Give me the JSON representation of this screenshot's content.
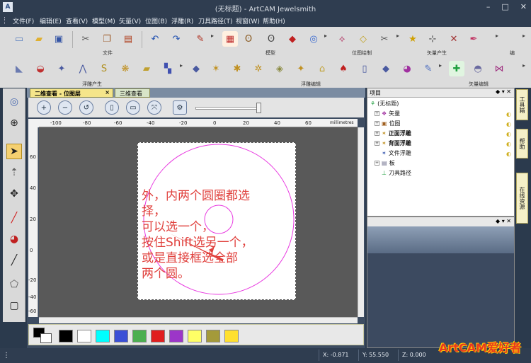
{
  "window": {
    "title": "(无标题) - ArtCAM Jewelsmith",
    "minimize": "–",
    "maximize": "□",
    "close": "✕"
  },
  "menu": {
    "items": [
      "文件(F)",
      "编辑(E)",
      "查看(V)",
      "模型(M)",
      "矢量(V)",
      "位图(B)",
      "浮雕(R)",
      "刀具路径(T)",
      "视窗(W)",
      "帮助(H)"
    ]
  },
  "toolbars": {
    "file_label": "文件",
    "model_label": "模型",
    "bitmap_label": "位图绘制",
    "vector_gen_label": "矢量产生",
    "edit_label": "编",
    "relief_gen_label": "浮雕产生",
    "relief_edit_label": "浮雕编辑",
    "vector_edit_label": "矢量编辑"
  },
  "tabs": [
    {
      "label": "二维查看 - 位图层",
      "active": true,
      "close": "×"
    },
    {
      "label": "三维查看",
      "active": false
    }
  ],
  "ruler": {
    "h_ticks": [
      "-100",
      "-80",
      "-60",
      "-40",
      "-20",
      "0",
      "20",
      "40",
      "60",
      "millimetres"
    ],
    "v_ticks": [
      "60",
      "40",
      "20",
      "0",
      "-20",
      "-40",
      "-60"
    ]
  },
  "annotation": {
    "lines": [
      "外，内两个圆圈都选",
      "择，",
      "可以选一个，",
      "按住Shift选另一个，",
      "或是直接框选全部",
      "两个圆。"
    ]
  },
  "palette": {
    "colors": [
      "#000000",
      "#ffffff",
      "#00ffff",
      "#3a4fd6",
      "#4caf50",
      "#e01e1e",
      "#9c36c8",
      "#ffff66",
      "#a49a3a",
      "#ffe030"
    ]
  },
  "project": {
    "header": "项目",
    "tree": [
      {
        "label": "(无标题)",
        "bold": false
      },
      {
        "label": "矢量",
        "bold": false
      },
      {
        "label": "位图",
        "bold": false
      },
      {
        "label": "正面浮雕",
        "bold": true
      },
      {
        "label": "背面浮雕",
        "bold": true
      },
      {
        "label": "文件浮雕",
        "bold": false
      },
      {
        "label": "板",
        "bold": false
      },
      {
        "label": "刀具路径",
        "bold": false
      }
    ]
  },
  "side_tabs": [
    "工具箱",
    "帮助",
    "在线资源"
  ],
  "status": {
    "x": "X: -0.871",
    "y": "Y: 55.550",
    "z": "Z: 0.000"
  },
  "watermark": "ArtCAM爱好者",
  "colors": {
    "accent_pink": "#e83ae0",
    "annotation_red": "#e0403c"
  }
}
